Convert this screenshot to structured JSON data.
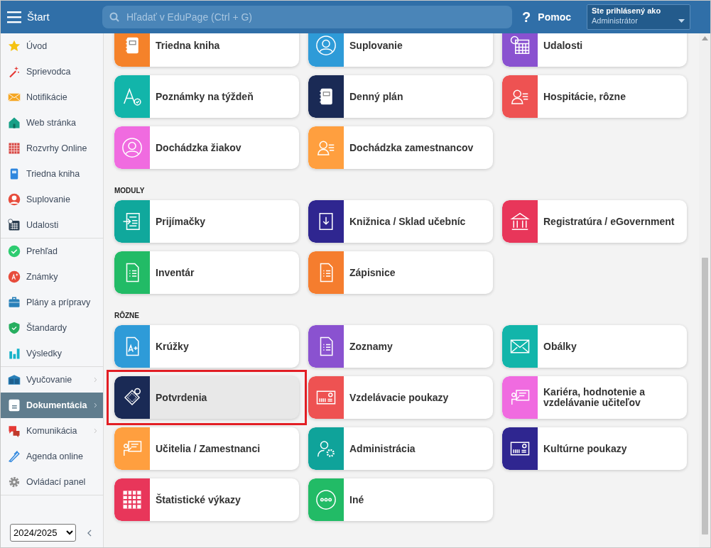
{
  "header": {
    "menu_label": "Štart",
    "search": {
      "placeholder": "Hľadať v EduPage (Ctrl + G)"
    },
    "help_icon": "?",
    "help": "Pomoc",
    "user": {
      "caption": "Ste prihlásený ako",
      "role": "Administrátor"
    }
  },
  "sidebar": {
    "groups": [
      {
        "items": [
          {
            "label": "Úvod",
            "selected": false,
            "has_submenu": false
          },
          {
            "label": "Sprievodca",
            "selected": false,
            "has_submenu": false
          },
          {
            "label": "Notifikácie",
            "selected": false,
            "has_submenu": false
          },
          {
            "label": "Web stránka",
            "selected": false,
            "has_submenu": false
          },
          {
            "label": "Rozvrhy Online",
            "selected": false,
            "has_submenu": false
          },
          {
            "label": "Triedna kniha",
            "selected": false,
            "has_submenu": false
          },
          {
            "label": "Suplovanie",
            "selected": false,
            "has_submenu": false
          },
          {
            "label": "Udalosti",
            "selected": false,
            "has_submenu": false
          }
        ]
      },
      {
        "items": [
          {
            "label": "Prehľad",
            "selected": false,
            "has_submenu": false
          },
          {
            "label": "Známky",
            "selected": false,
            "has_submenu": false
          },
          {
            "label": "Plány a prípravy",
            "selected": false,
            "has_submenu": false
          },
          {
            "label": "Štandardy",
            "selected": false,
            "has_submenu": false
          },
          {
            "label": "Výsledky",
            "selected": false,
            "has_submenu": false
          }
        ]
      },
      {
        "items": [
          {
            "label": "Vyučovanie",
            "selected": false,
            "has_submenu": true
          },
          {
            "label": "Dokumentácia",
            "selected": true,
            "has_submenu": true
          },
          {
            "label": "Komunikácia",
            "selected": false,
            "has_submenu": true
          },
          {
            "label": "Agenda online",
            "selected": false,
            "has_submenu": false
          },
          {
            "label": "Ovládací panel",
            "selected": false,
            "has_submenu": false
          }
        ]
      }
    ],
    "year_select": "2024/2025"
  },
  "sections": [
    {
      "tiles": [
        {
          "label": "Triedna kniha",
          "color": "#f5822a",
          "highlighted": false
        },
        {
          "label": "Suplovanie",
          "color": "#2e9bd8",
          "highlighted": false
        },
        {
          "label": "Udalosti",
          "color": "#8a52d0",
          "highlighted": false
        },
        {
          "label": "Poznámky na týždeň",
          "color": "#12b5aa",
          "highlighted": false
        },
        {
          "label": "Denný plán",
          "color": "#1a2a55",
          "highlighted": false
        },
        {
          "label": "Hospitácie, rôzne",
          "color": "#ee5252",
          "highlighted": false
        },
        {
          "label": "Dochádzka žiakov",
          "color": "#f06be0",
          "highlighted": false
        },
        {
          "label": "Dochádzka zamestnancov",
          "color": "#ff9f3f",
          "highlighted": false
        }
      ]
    },
    {
      "title": "MODULY",
      "tiles": [
        {
          "label": "Prijímačky",
          "color": "#10a89c",
          "highlighted": false
        },
        {
          "label": "Knižnica / Sklad učebníc",
          "color": "#2f2690",
          "highlighted": false
        },
        {
          "label": "Registratúra / eGovernment",
          "color": "#e8365a",
          "highlighted": false
        },
        {
          "label": "Inventár",
          "color": "#22bb66",
          "highlighted": false
        },
        {
          "label": "Zápisnice",
          "color": "#f57d2e",
          "highlighted": false
        }
      ]
    },
    {
      "title": "RÔZNE",
      "tiles": [
        {
          "label": "Krúžky",
          "color": "#2e9bd8",
          "highlighted": false
        },
        {
          "label": "Zoznamy",
          "color": "#8a52d0",
          "highlighted": false
        },
        {
          "label": "Obálky",
          "color": "#12b5aa",
          "highlighted": false
        },
        {
          "label": "Potvrdenia",
          "color": "#1a2a55",
          "highlighted": true
        },
        {
          "label": "Vzdelávacie poukazy",
          "color": "#ee5252",
          "highlighted": false
        },
        {
          "label": "Kariéra, hodnotenie a vzdelávanie učiteľov",
          "color": "#f06be0",
          "highlighted": false
        },
        {
          "label": "Učitelia / Zamestnanci",
          "color": "#ff9f3f",
          "highlighted": false
        },
        {
          "label": "Administrácia",
          "color": "#0fa39a",
          "highlighted": false
        },
        {
          "label": "Kultúrne poukazy",
          "color": "#2f2690",
          "highlighted": false
        },
        {
          "label": "Štatistické výkazy",
          "color": "#e8365a",
          "highlighted": false
        },
        {
          "label": "Iné",
          "color": "#22bb66",
          "highlighted": false
        }
      ]
    }
  ]
}
